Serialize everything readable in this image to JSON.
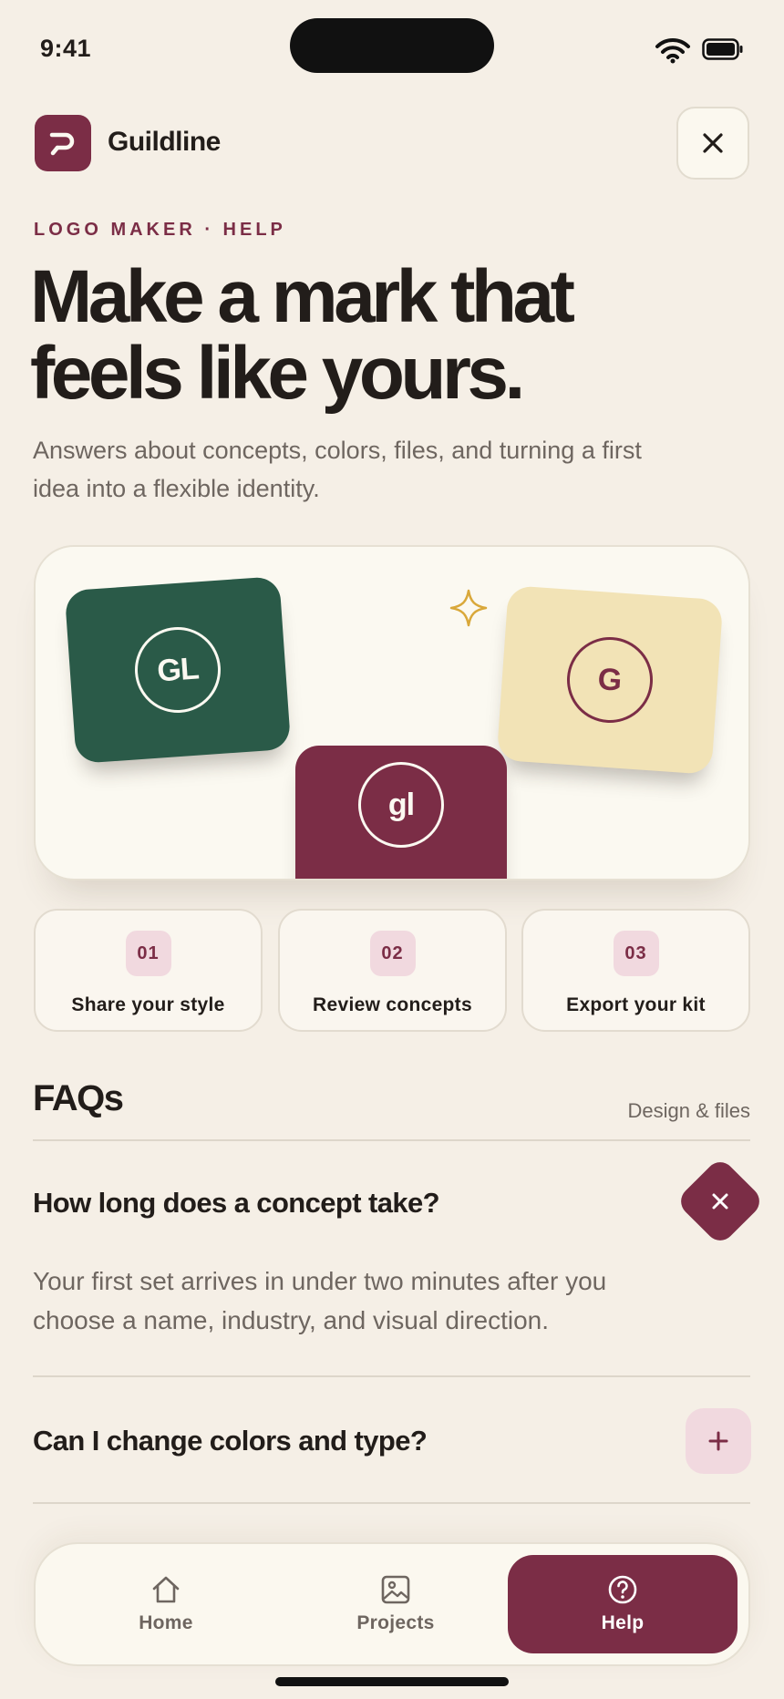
{
  "status_bar": {
    "time": "9:41"
  },
  "header": {
    "app_name": "Guildline"
  },
  "hero": {
    "eyebrow": "LOGO MAKER · HELP",
    "headline_line1": "Make a mark that",
    "headline_line2": "feels like yours.",
    "subtext": "Answers about concepts, colors, files, and turning a first idea into a flexible identity."
  },
  "preview": {
    "tiles": [
      {
        "monogram": "GL",
        "color": "#2a5a48"
      },
      {
        "monogram": "G",
        "color": "#f2e3b6"
      },
      {
        "monogram": "gl",
        "color": "#7b2d46"
      }
    ]
  },
  "steps": [
    {
      "number": "01",
      "label": "Share your style"
    },
    {
      "number": "02",
      "label": "Review concepts"
    },
    {
      "number": "03",
      "label": "Export your kit"
    }
  ],
  "faq": {
    "title": "FAQs",
    "meta": "Design & files",
    "items": [
      {
        "question": "How long does a concept take?",
        "answer": "Your first set arrives in under two minutes after you choose a name, industry, and visual direction.",
        "expanded": true
      },
      {
        "question": "Can I change colors and type?",
        "expanded": false
      }
    ]
  },
  "tabbar": {
    "items": [
      {
        "label": "Home",
        "icon": "home-icon"
      },
      {
        "label": "Projects",
        "icon": "image-icon"
      },
      {
        "label": "Help",
        "icon": "help-circle-icon",
        "active": true
      }
    ]
  },
  "colors": {
    "background": "#f5efe6",
    "brand": "#7b2d46",
    "green": "#2a5a48",
    "yellow": "#f2e3b6",
    "accent_soft": "#f1d9df",
    "sparkle": "#d9a83a"
  }
}
